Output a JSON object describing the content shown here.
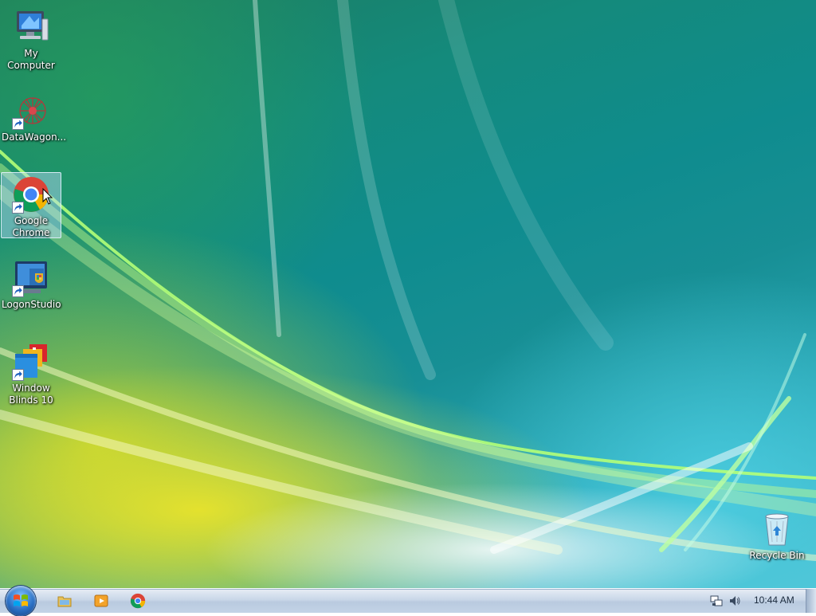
{
  "desktop": {
    "icons": [
      {
        "id": "my-computer",
        "label": "My Computer",
        "icon": "computer-icon",
        "shortcut": false,
        "selected": false
      },
      {
        "id": "datawagon",
        "label": "DataWagon...",
        "icon": "datawagon-icon",
        "shortcut": true,
        "selected": false
      },
      {
        "id": "google-chrome",
        "label": "Google Chrome",
        "icon": "chrome-icon",
        "shortcut": true,
        "selected": true
      },
      {
        "id": "logonstudio",
        "label": "LogonStudio",
        "icon": "logonstudio-icon",
        "shortcut": true,
        "selected": false
      },
      {
        "id": "windowblinds",
        "label": "Window Blinds 10",
        "icon": "windowblinds-icon",
        "shortcut": true,
        "selected": false
      },
      {
        "id": "recycle-bin",
        "label": "Recycle Bin",
        "icon": "recycle-bin-icon",
        "shortcut": false,
        "selected": false
      }
    ]
  },
  "taskbar": {
    "start_icon": "windows-logo-icon",
    "quick_launch": [
      "file-explorer-icon",
      "media-player-icon",
      "chrome-icon"
    ],
    "tray": [
      "network-icon",
      "volume-icon"
    ],
    "clock": "10:44 AM"
  },
  "colors": {
    "taskbar": "#c9d7e8",
    "selection": "#bedcfa",
    "label_text": "#ffffff"
  }
}
